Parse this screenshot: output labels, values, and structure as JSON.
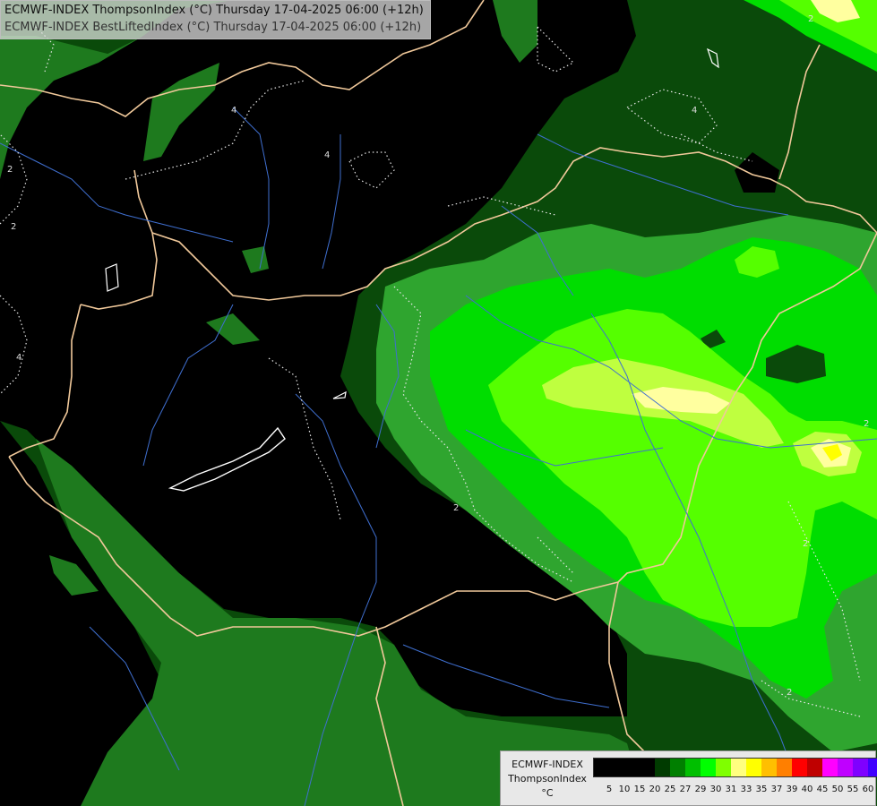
{
  "header": {
    "line1": "ECMWF-INDEX ThompsonIndex (°C) Thursday 17-04-2025 06:00 (+12h)",
    "line2": "ECMWF-INDEX BestLiftedIndex (°C) Thursday 17-04-2025 06:00 (+12h)"
  },
  "legend": {
    "model": "ECMWF-INDEX",
    "parameter": "ThompsonIndex",
    "unit": "°C",
    "tick_labels": [
      "5",
      "10",
      "15",
      "20",
      "25",
      "27",
      "29",
      "30",
      "31",
      "33",
      "35",
      "37",
      "39",
      "40",
      "45",
      "50",
      "55",
      "60"
    ],
    "colors": [
      "#000000",
      "#000000",
      "#000000",
      "#000000",
      "#003b00",
      "#007f00",
      "#00bf00",
      "#00ff00",
      "#7fff00",
      "#ffff7f",
      "#ffff00",
      "#ffbf00",
      "#ff7f00",
      "#ff0000",
      "#bf0000",
      "#ff00ff",
      "#bf00ff",
      "#7f00ff",
      "#3f00ff",
      "#0000ff"
    ]
  },
  "map": {
    "contour_labels": [
      "4",
      "4",
      "4",
      "4",
      "2",
      "2",
      "2",
      "2",
      "2",
      "2",
      "2"
    ],
    "fill_colors": {
      "black": "#000000",
      "dark_green": "#0a4a0a",
      "forest_green": "#1e7a1e",
      "medium_green": "#2fa52f",
      "bright_green": "#00dd00",
      "lime_green": "#55ff00",
      "yellow_green": "#bfff3f",
      "pale_yellow": "#ffff9f"
    }
  }
}
